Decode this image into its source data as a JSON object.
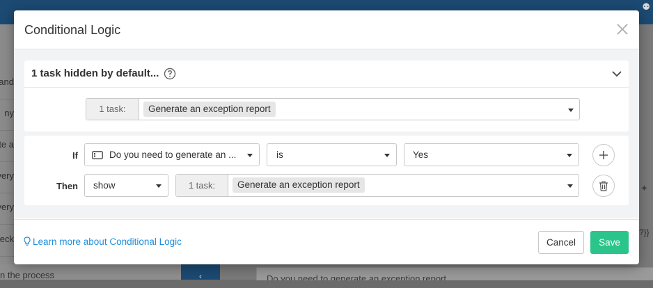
{
  "background": {
    "sidebar_items": [
      "and",
      "ny",
      "te a",
      "very",
      "very",
      "neck"
    ],
    "bottom_left_text": "n the process",
    "main_field_text": "Do you need to generate an exception report",
    "side_snippet": "?}}"
  },
  "modal": {
    "title": "Conditional Logic",
    "hidden_section": {
      "title": "1 task hidden by default...",
      "task_count": "1 task:",
      "task_chip": "Generate an exception report"
    },
    "rule": {
      "if_label": "If",
      "question": "Do you need to generate an ...",
      "operator": "is",
      "value": "Yes",
      "then_label": "Then",
      "action": "show",
      "task_count": "1 task:",
      "task_chip": "Generate an exception report"
    },
    "footer": {
      "learn_more": "Learn more about Conditional Logic",
      "cancel_label": "Cancel",
      "save_label": "Save"
    }
  },
  "colors": {
    "accent_link": "#1f8fdc",
    "save_button": "#2bc48a",
    "topbar": "#1c4a72"
  },
  "icons": {
    "close": "close-icon",
    "help": "question-circle-icon",
    "collapse": "chevron-down-icon",
    "add": "plus-icon",
    "delete": "trash-icon",
    "learn": "lightbulb-icon",
    "question_type": "form-field-icon"
  }
}
